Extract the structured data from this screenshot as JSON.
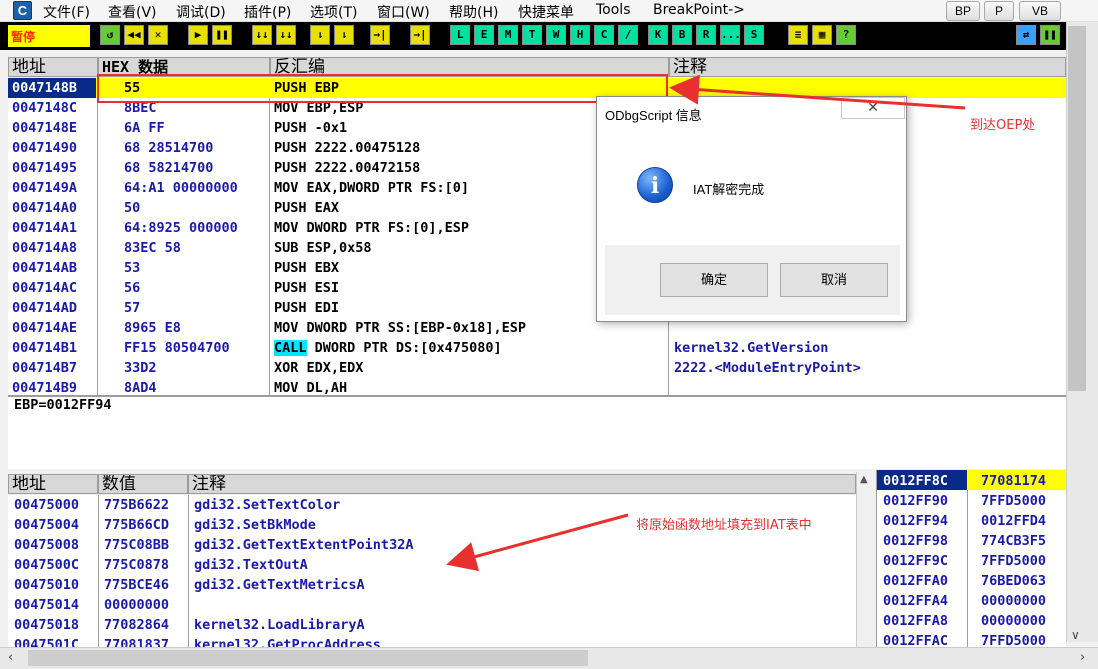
{
  "menu": {
    "app_icon": "C",
    "items": [
      "文件(F)",
      "查看(V)",
      "调试(D)",
      "插件(P)",
      "选项(T)",
      "窗口(W)",
      "帮助(H)",
      "快捷菜单",
      "Tools",
      "BreakPoint->"
    ],
    "side_buttons": [
      "BP",
      "P",
      "VB"
    ]
  },
  "toolbar": {
    "status": "暂停",
    "buttons": [
      "↺",
      "◀◀",
      "✕",
      "▶",
      "❚❚",
      "↓↓",
      "↓↓",
      "⇂",
      "⇂",
      "→|",
      "→|",
      "L",
      "E",
      "M",
      "T",
      "W",
      "H",
      "C",
      "/",
      "K",
      "B",
      "R",
      "...",
      "S",
      "≡",
      "▦",
      "?",
      "⇄",
      "❚❚"
    ]
  },
  "cpu": {
    "headers": [
      "地址",
      "HEX 数据",
      "反汇编",
      "注释"
    ],
    "rows": [
      {
        "addr": "0047148B",
        "hex": "55",
        "disasm": "PUSH EBP",
        "comment": ""
      },
      {
        "addr": "0047148C",
        "hex": "8BEC",
        "disasm": "MOV EBP,ESP",
        "comment": ""
      },
      {
        "addr": "0047148E",
        "hex": "6A FF",
        "disasm": "PUSH -0x1",
        "comment": ""
      },
      {
        "addr": "00471490",
        "hex": "68 28514700",
        "disasm": "PUSH 2222.00475128",
        "comment": ""
      },
      {
        "addr": "00471495",
        "hex": "68 58214700",
        "disasm": "PUSH 2222.00472158",
        "comment": ""
      },
      {
        "addr": "0047149A",
        "hex": "64:A1 00000000",
        "disasm": "MOV EAX,DWORD PTR FS:[0]",
        "comment": ""
      },
      {
        "addr": "004714A0",
        "hex": "50",
        "disasm": "PUSH EAX",
        "comment": ""
      },
      {
        "addr": "004714A1",
        "hex": "64:8925 000000",
        "disasm": "MOV DWORD PTR FS:[0],ESP",
        "comment": ""
      },
      {
        "addr": "004714A8",
        "hex": "83EC 58",
        "disasm": "SUB ESP,0x58",
        "comment": ""
      },
      {
        "addr": "004714AB",
        "hex": "53",
        "disasm": "PUSH EBX",
        "comment": ""
      },
      {
        "addr": "004714AC",
        "hex": "56",
        "disasm": "PUSH ESI",
        "comment": ""
      },
      {
        "addr": "004714AD",
        "hex": "57",
        "disasm": "PUSH EDI",
        "comment": ""
      },
      {
        "addr": "004714AE",
        "hex": "8965 E8",
        "disasm": "MOV DWORD PTR SS:[EBP-0x18],ESP",
        "comment": ""
      },
      {
        "addr": "004714B1",
        "hex": "FF15 80504700",
        "disasm_call": "CALL",
        "disasm": " DWORD PTR DS:[0x475080]",
        "comment": "kernel32.GetVersion"
      },
      {
        "addr": "004714B7",
        "hex": "33D2",
        "disasm": "XOR EDX,EDX",
        "comment": "2222.<ModuleEntryPoint>"
      },
      {
        "addr": "004714B9",
        "hex": "8AD4",
        "disasm": "MOV DL,AH",
        "comment": ""
      }
    ],
    "info_line": "EBP=0012FF94"
  },
  "dump": {
    "headers": [
      "地址",
      "数值",
      "注释"
    ],
    "rows": [
      {
        "addr": "00475000",
        "value": "775B6622",
        "comment": "gdi32.SetTextColor"
      },
      {
        "addr": "00475004",
        "value": "775B66CD",
        "comment": "gdi32.SetBkMode"
      },
      {
        "addr": "00475008",
        "value": "775C08BB",
        "comment": "gdi32.GetTextExtentPoint32A"
      },
      {
        "addr": "0047500C",
        "value": "775C0878",
        "comment": "gdi32.TextOutA"
      },
      {
        "addr": "00475010",
        "value": "775BCE46",
        "comment": "gdi32.GetTextMetricsA"
      },
      {
        "addr": "00475014",
        "value": "00000000",
        "comment": ""
      },
      {
        "addr": "00475018",
        "value": "77082864",
        "comment": "kernel32.LoadLibraryA"
      },
      {
        "addr": "0047501C",
        "value": "77081837",
        "comment": "kernel32.GetProcAddress"
      }
    ]
  },
  "stack": {
    "rows": [
      {
        "addr": "0012FF8C",
        "value": "77081174"
      },
      {
        "addr": "0012FF90",
        "value": "7FFD5000"
      },
      {
        "addr": "0012FF94",
        "value": "0012FFD4"
      },
      {
        "addr": "0012FF98",
        "value": "774CB3F5"
      },
      {
        "addr": "0012FF9C",
        "value": "7FFD5000"
      },
      {
        "addr": "0012FFA0",
        "value": "76BED063"
      },
      {
        "addr": "0012FFA4",
        "value": "00000000"
      },
      {
        "addr": "0012FFA8",
        "value": "00000000"
      },
      {
        "addr": "0012FFAC",
        "value": "7FFD5000"
      }
    ]
  },
  "dialog": {
    "title": "ODbgScript 信息",
    "close": "✕",
    "icon": "i",
    "message": "IAT解密完成",
    "ok": "确定",
    "cancel": "取消"
  },
  "annotations": {
    "oep": "到达OEP处",
    "iat": "将原始函数地址填充到IAT表中"
  },
  "colors": {
    "accent_red": "#e8302e",
    "highlight": "#ffff00",
    "selected": "#0a2a8a",
    "text_blue": "#1a1aaa"
  }
}
